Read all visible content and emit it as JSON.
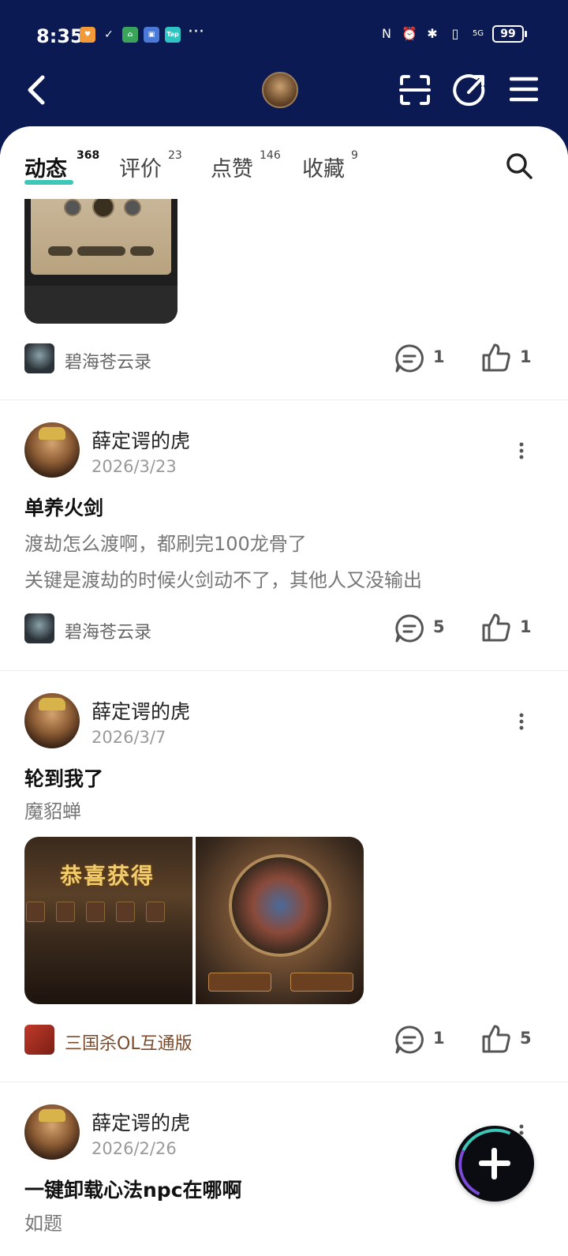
{
  "status_bar": {
    "time": "8:35",
    "more": "···",
    "battery": "99",
    "network": "5G"
  },
  "tabs": [
    {
      "label": "动态",
      "count": "368",
      "active": true
    },
    {
      "label": "评价",
      "count": "23"
    },
    {
      "label": "点赞",
      "count": "146"
    },
    {
      "label": "收藏",
      "count": "9"
    }
  ],
  "posts": [
    {
      "source": "碧海苍云录",
      "comments": "1",
      "likes": "1"
    },
    {
      "author": "薛定谔的虎",
      "date": "2026/3/23",
      "title": "单养火剑",
      "body": [
        "渡劫怎么渡啊，都刷完100龙骨了",
        "关键是渡劫的时候火剑动不了，其他人又没输出"
      ],
      "source": "碧海苍云录",
      "comments": "5",
      "likes": "1"
    },
    {
      "author": "薛定谔的虎",
      "date": "2026/3/7",
      "title": "轮到我了",
      "body": [
        "魔貂蝉"
      ],
      "image_text": "恭喜获得",
      "source": "三国杀OL互通版",
      "comments": "1",
      "likes": "5"
    },
    {
      "author": "薛定谔的虎",
      "date": "2026/2/26",
      "title": "一键卸载心法npc在哪啊",
      "body": [
        "如题"
      ]
    }
  ],
  "colors": {
    "header_bg": "#0b1a52",
    "accent": "#3ec6b7",
    "sgs_source_text": "#7a4a2a"
  }
}
